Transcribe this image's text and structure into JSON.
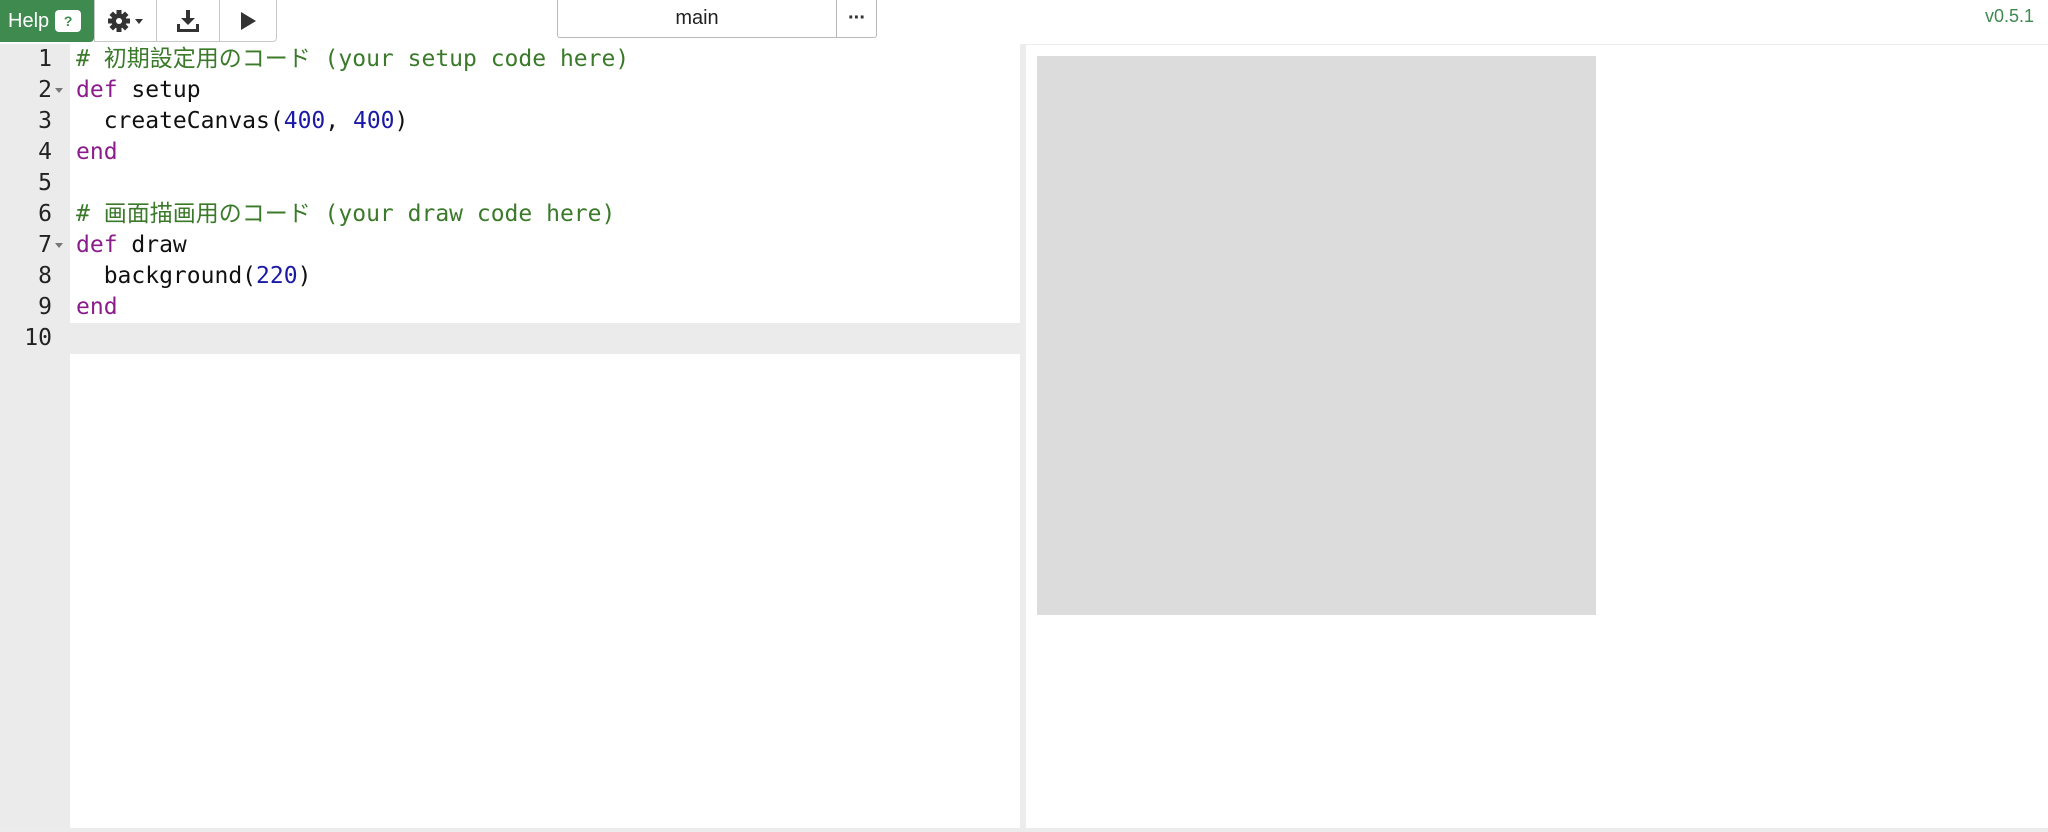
{
  "toolbar": {
    "help_label": "Help",
    "help_badge": "?",
    "settings_icon": "gear-icon",
    "download_icon": "download-icon",
    "run_icon": "play-icon",
    "file_name": "main",
    "more_label": "···"
  },
  "version": "v0.5.1",
  "editor": {
    "lines": [
      {
        "no": "1",
        "fold": false,
        "tokens": [
          {
            "t": "comment",
            "v": "# 初期設定用のコード (your setup code here)"
          }
        ]
      },
      {
        "no": "2",
        "fold": true,
        "tokens": [
          {
            "t": "keyword",
            "v": "def"
          },
          {
            "t": "plain",
            "v": " setup"
          }
        ]
      },
      {
        "no": "3",
        "fold": false,
        "tokens": [
          {
            "t": "plain",
            "v": "  createCanvas("
          },
          {
            "t": "number",
            "v": "400"
          },
          {
            "t": "plain",
            "v": ", "
          },
          {
            "t": "number",
            "v": "400"
          },
          {
            "t": "plain",
            "v": ")"
          }
        ]
      },
      {
        "no": "4",
        "fold": false,
        "tokens": [
          {
            "t": "keyword",
            "v": "end"
          }
        ]
      },
      {
        "no": "5",
        "fold": false,
        "tokens": []
      },
      {
        "no": "6",
        "fold": false,
        "tokens": [
          {
            "t": "comment",
            "v": "# 画面描画用のコード (your draw code here)"
          }
        ]
      },
      {
        "no": "7",
        "fold": true,
        "tokens": [
          {
            "t": "keyword",
            "v": "def"
          },
          {
            "t": "plain",
            "v": " draw"
          }
        ]
      },
      {
        "no": "8",
        "fold": false,
        "tokens": [
          {
            "t": "plain",
            "v": "  background("
          },
          {
            "t": "number",
            "v": "220"
          },
          {
            "t": "plain",
            "v": ")"
          }
        ]
      },
      {
        "no": "9",
        "fold": false,
        "tokens": [
          {
            "t": "keyword",
            "v": "end"
          }
        ]
      },
      {
        "no": "10",
        "fold": false,
        "tokens": []
      }
    ],
    "active_line": "10"
  },
  "colors": {
    "accent": "#3e8a4f",
    "comment": "#3a7a2a",
    "keyword": "#8b1c8b",
    "number": "#1a1aa6",
    "canvas_background": "#dcdcdc"
  }
}
